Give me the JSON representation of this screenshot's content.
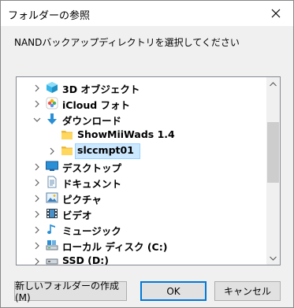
{
  "title": "フォルダーの参照",
  "instruction": "NANDバックアップディレクトリを選択してください",
  "tree": {
    "items": [
      {
        "label": "3D オブジェクト",
        "icon": "3d-objects-icon",
        "chevron": "right"
      },
      {
        "label": "iCloud フォト",
        "icon": "icloud-photos-icon",
        "chevron": "right"
      },
      {
        "label": "ダウンロード",
        "icon": "download-icon",
        "chevron": "down"
      },
      {
        "label": "ShowMiiWads 1.4",
        "icon": "folder-icon",
        "chevron": "none"
      },
      {
        "label": "slccmpt01",
        "icon": "folder-icon",
        "chevron": "right",
        "selected": true
      },
      {
        "label": "デスクトップ",
        "icon": "desktop-icon",
        "chevron": "right"
      },
      {
        "label": "ドキュメント",
        "icon": "documents-icon",
        "chevron": "right"
      },
      {
        "label": "ピクチャ",
        "icon": "pictures-icon",
        "chevron": "right"
      },
      {
        "label": "ビデオ",
        "icon": "videos-icon",
        "chevron": "right"
      },
      {
        "label": "ミュージック",
        "icon": "music-icon",
        "chevron": "right"
      },
      {
        "label": "ローカル ディスク (C:)",
        "icon": "local-disk-icon",
        "chevron": "right"
      },
      {
        "label": "SSD (D:)",
        "icon": "drive-icon",
        "chevron": "right"
      }
    ]
  },
  "buttons": {
    "new_folder": "新しいフォルダーの作成(M)",
    "ok": "OK",
    "cancel": "キャンセル"
  },
  "colors": {
    "selection": "#cce8ff",
    "folder": "#ffd75e",
    "accent": "#0078d7"
  }
}
